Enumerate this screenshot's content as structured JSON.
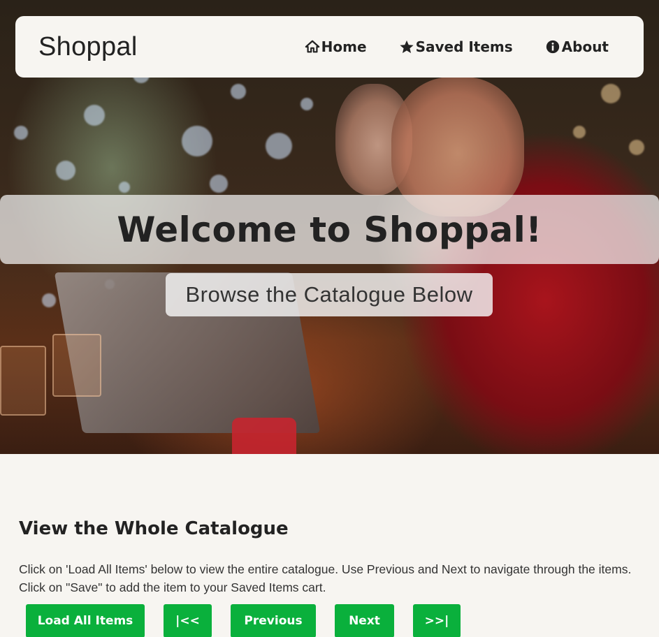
{
  "navbar": {
    "brand": "Shoppal",
    "links": [
      {
        "label": "Home",
        "icon": "home-icon"
      },
      {
        "label": "Saved Items",
        "icon": "star-icon"
      },
      {
        "label": "About",
        "icon": "info-icon"
      }
    ]
  },
  "hero": {
    "title": "Welcome to Shoppal!",
    "subtitle": "Browse the Catalogue Below"
  },
  "catalogue": {
    "heading": "View the Whole Catalogue",
    "description": "Click on 'Load All Items' below to view the entire catalogue. Use Previous and Next to navigate through the items. Click on \"Save\" to add the item to your Saved Items cart.",
    "buttons": {
      "load_all": "Load All Items",
      "first": "|<<",
      "previous": "Previous",
      "next": "Next",
      "last": ">>|"
    }
  },
  "colors": {
    "accent_green": "#0ab03c",
    "background": "#f7f5f1",
    "text": "#222222"
  }
}
